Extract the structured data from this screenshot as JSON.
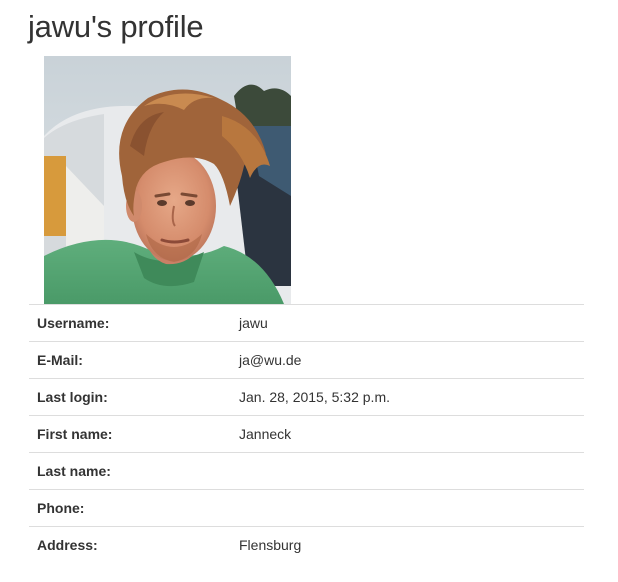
{
  "page": {
    "title": "jawu's profile"
  },
  "avatar": {
    "description_icon": "profile-photo"
  },
  "profile": {
    "rows": [
      {
        "label": "Username:",
        "value": "jawu"
      },
      {
        "label": "E-Mail:",
        "value": "ja@wu.de"
      },
      {
        "label": "Last login:",
        "value": "Jan. 28, 2015, 5:32 p.m."
      },
      {
        "label": "First name:",
        "value": "Janneck"
      },
      {
        "label": "Last name:",
        "value": ""
      },
      {
        "label": "Phone:",
        "value": ""
      },
      {
        "label": "Address:",
        "value": "Flensburg"
      }
    ]
  }
}
